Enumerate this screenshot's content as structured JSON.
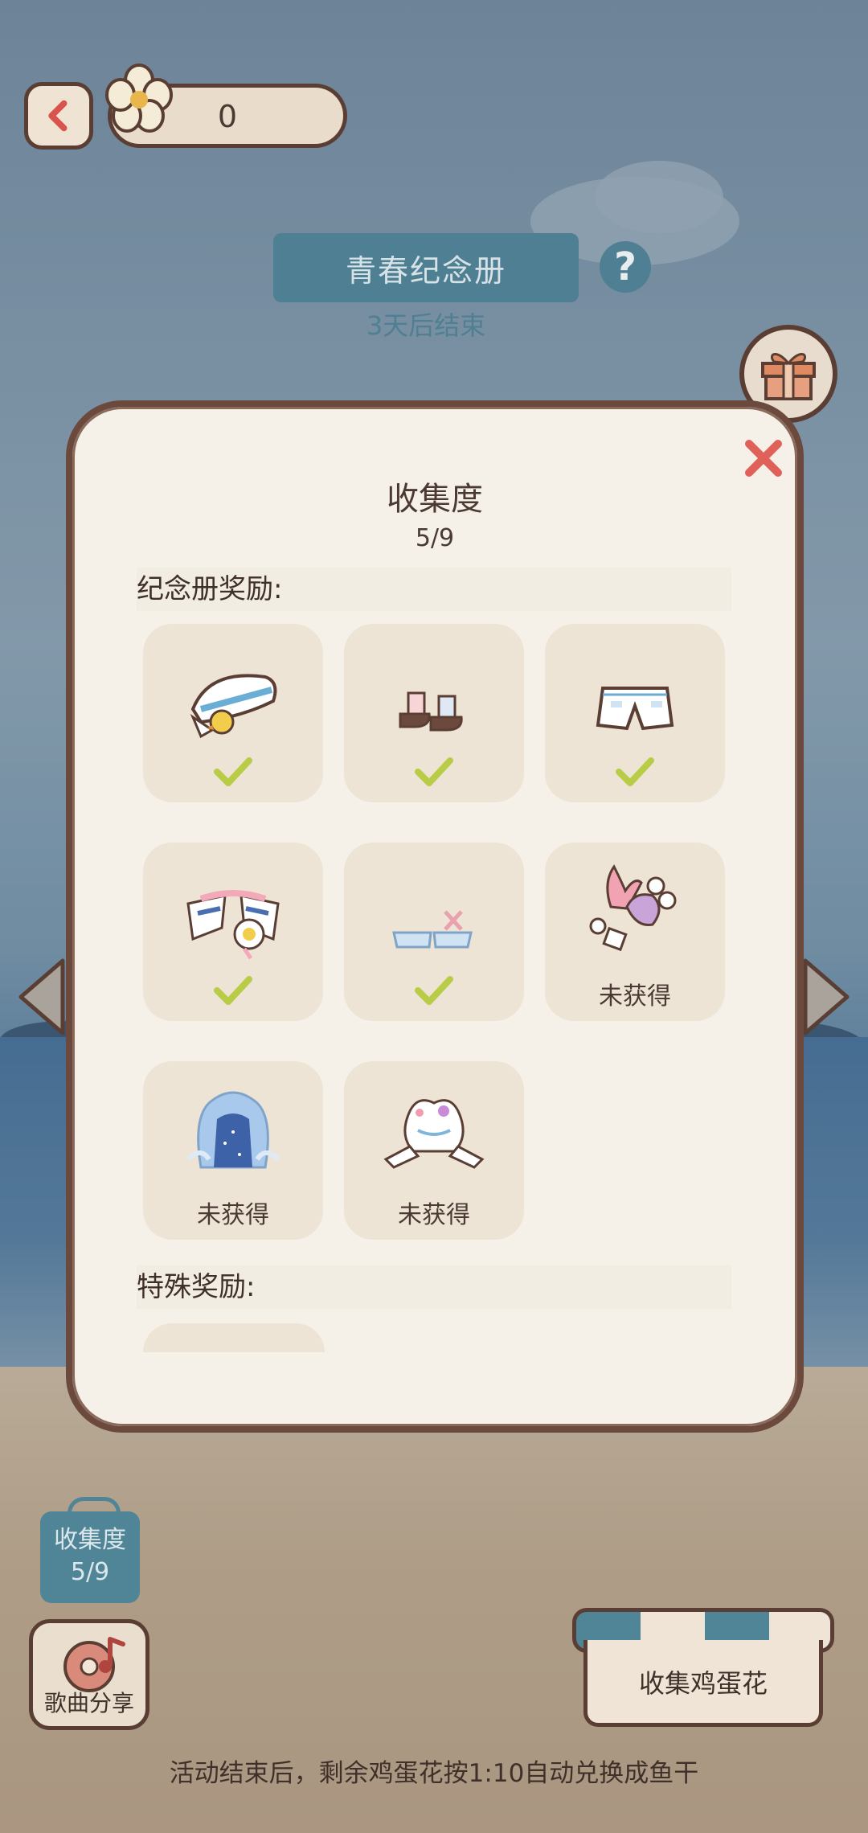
{
  "header": {
    "currency_value": "0",
    "event_title": "青春纪念册",
    "event_subtitle": "3天后结束"
  },
  "modal": {
    "title": "收集度",
    "progress": "5/9",
    "section_album": "纪念册奖励:",
    "section_special": "特殊奖励:",
    "items": [
      {
        "name": "sailor-hat",
        "obtained": true
      },
      {
        "name": "socks-shoes",
        "obtained": true
      },
      {
        "name": "white-shorts",
        "obtained": true
      },
      {
        "name": "sailor-collar",
        "obtained": true
      },
      {
        "name": "blue-sandals",
        "obtained": true
      },
      {
        "name": "coral-shell-accessory",
        "obtained": false,
        "status": "未获得"
      },
      {
        "name": "blue-hair",
        "obtained": false,
        "status": "未获得"
      },
      {
        "name": "cloud-seat",
        "obtained": false,
        "status": "未获得"
      }
    ]
  },
  "bottom": {
    "collect_label": "收集度",
    "collect_count": "5/9",
    "song_share_label": "歌曲分享",
    "shop_label": "收集鸡蛋花",
    "footer_note": "活动结束后，剩余鸡蛋花按1:10自动兑换成鱼干"
  },
  "colors": {
    "accent_teal": "#4f7f93",
    "frame_brown": "#6b4a3d",
    "check_green": "#b8cc46",
    "close_red": "#e0615a"
  }
}
